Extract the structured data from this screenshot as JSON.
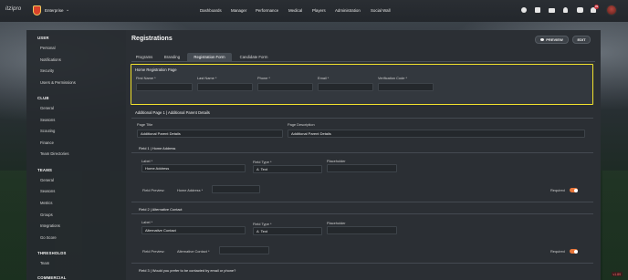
{
  "app": {
    "brand": "itzipro",
    "club": "Enterprise",
    "nav": [
      "Dashboards",
      "Manager",
      "Performance",
      "Medical",
      "Players",
      "Administration",
      "Social Wall"
    ],
    "notification_count": "99",
    "version": "v1.89"
  },
  "sidebar": {
    "sections": [
      {
        "title": "USER",
        "items": [
          "Personal",
          "Notifications",
          "Security",
          "Users & Permissions"
        ]
      },
      {
        "title": "CLUB",
        "items": [
          "General",
          "Seasons",
          "Scouting",
          "Finance",
          "Team Directories"
        ]
      },
      {
        "title": "TEAMS",
        "items": [
          "General",
          "Seasons",
          "Metrics",
          "Groups",
          "Integrations",
          "Go Score"
        ]
      },
      {
        "title": "THRESHOLDS",
        "items": [
          "Team"
        ]
      },
      {
        "title": "COMMERCIAL",
        "items": []
      }
    ]
  },
  "page": {
    "title": "Registrations",
    "preview_label": "PREVIEW",
    "edit_label": "EDIT",
    "tabs": [
      "Programs",
      "Branding",
      "Registration Form",
      "Candidate Form"
    ],
    "active_tab": "Registration Form"
  },
  "home_page": {
    "title": "Home Registration Page",
    "fields": [
      "First Name *",
      "Last Name *",
      "Phone *",
      "Email *",
      "Verification Code *"
    ]
  },
  "additional": {
    "title": "Additional Page 1 | Additional Parent Details",
    "page_title_label": "Page Title",
    "page_title_value": "Additional Parent Details",
    "page_desc_label": "Page Description",
    "page_desc_value": "Additional Parent Details",
    "field1": {
      "title": "Field 1 | Home Address",
      "label_label": "Label *",
      "label_value": "Home Address",
      "type_label": "Field Type *",
      "type_value": "Text",
      "placeholder_label": "Placeholder",
      "preview_label": "Field Preview:",
      "preview_field": "Home Address *",
      "required_label": "Required"
    },
    "field2": {
      "title": "Field 2 | Alternative Contact",
      "label_label": "Label *",
      "label_value": "Alternative Contact",
      "type_label": "Field Type *",
      "type_value": "Text",
      "placeholder_label": "Placeholder",
      "preview_label": "Field Preview:",
      "preview_field": "Alternative Contact *",
      "required_label": "Required"
    },
    "field3": {
      "title": "Field 3 | Would you prefer to be contacted by email or phone?"
    }
  }
}
